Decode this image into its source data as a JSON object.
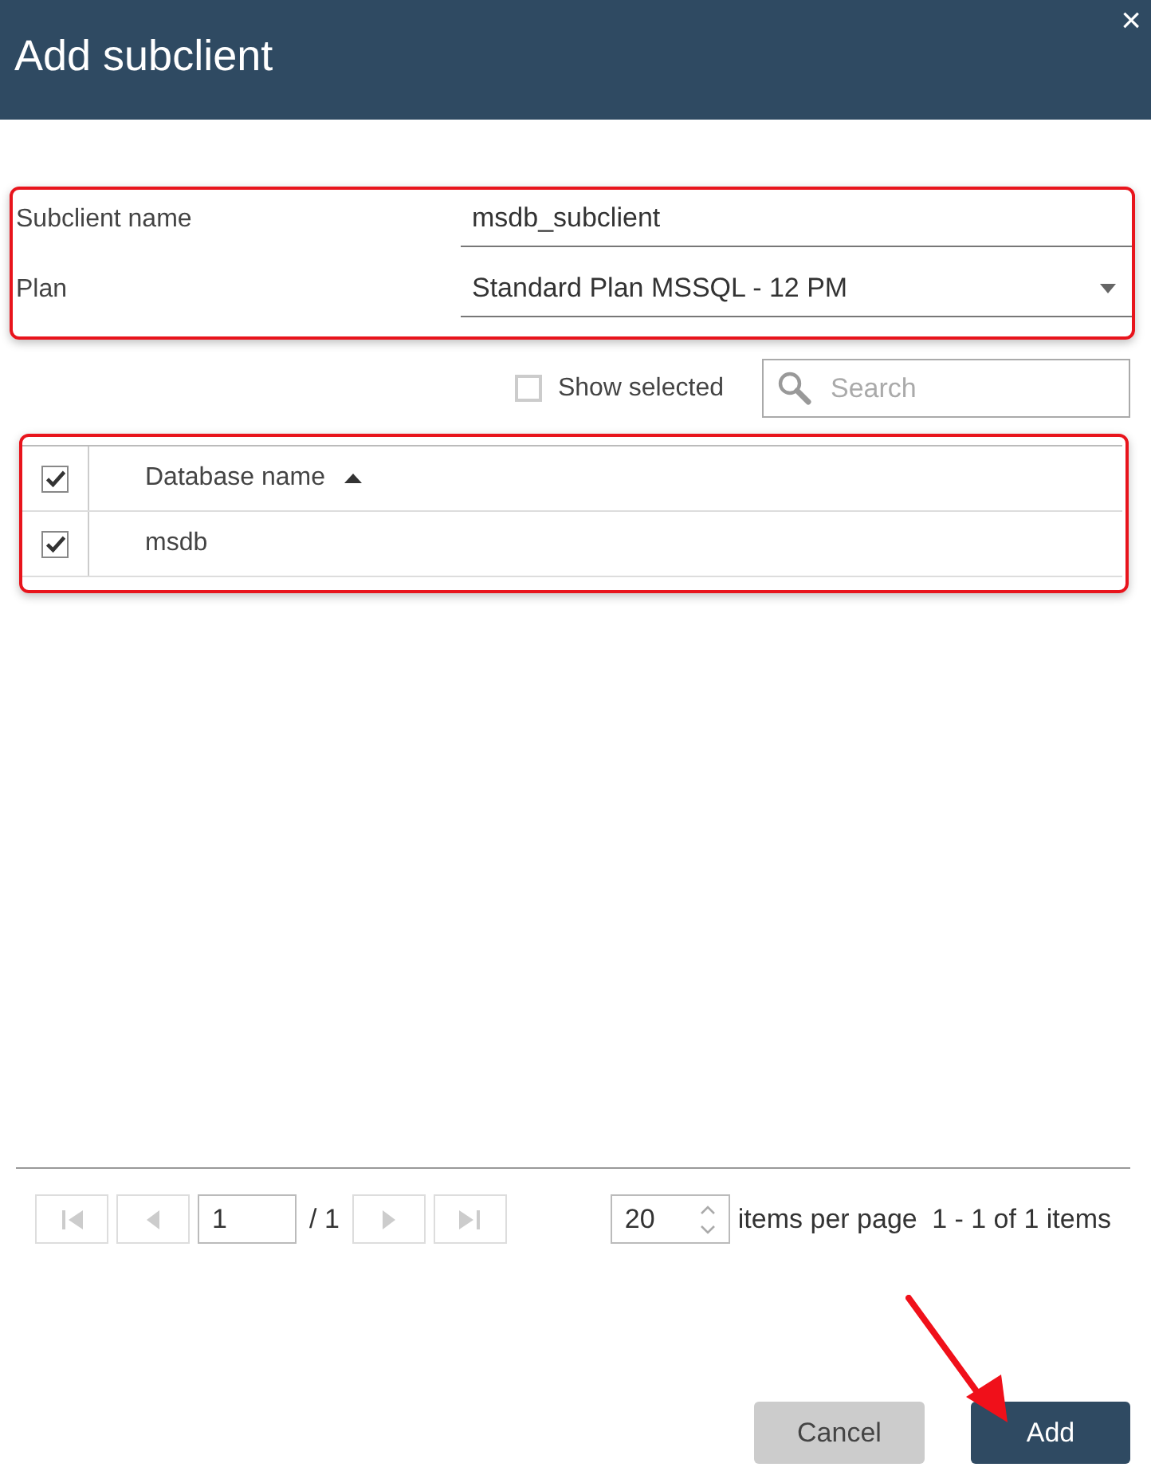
{
  "dialog": {
    "title": "Add subclient",
    "close": "×"
  },
  "form": {
    "fields": [
      {
        "kind": "text",
        "label": "Subclient name",
        "value": "msdb_subclient"
      },
      {
        "kind": "select",
        "label": "Plan",
        "value": "Standard Plan MSSQL - 12 PM"
      }
    ]
  },
  "toolbar": {
    "show_selected": {
      "label": "Show selected",
      "checked": false
    },
    "search": {
      "placeholder": "Search"
    }
  },
  "table": {
    "header_checked": true,
    "columns": [
      {
        "label": "Database name",
        "sorted_ascending": true
      }
    ],
    "rows": [
      {
        "cells": [
          "msdb"
        ],
        "checked": true
      }
    ]
  },
  "pager": {
    "page": "1",
    "total": "/ 1",
    "page_size": "20",
    "page_size_label": "items per page",
    "summary": "1 - 1 of 1 items"
  },
  "buttons": [
    {
      "label": "Cancel",
      "kind": "secondary"
    },
    {
      "label": "Add",
      "kind": "primary"
    }
  ]
}
